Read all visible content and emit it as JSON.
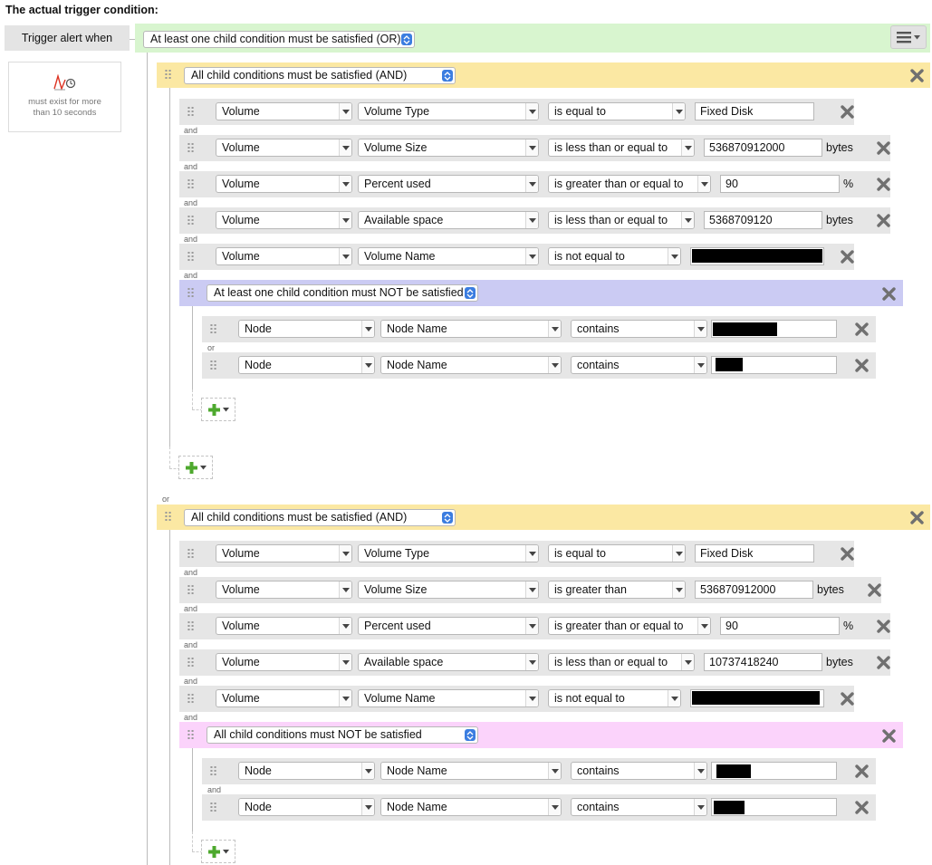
{
  "heading": "The actual trigger condition:",
  "trigger_label": "Trigger alert when",
  "info": {
    "line1": "must exist for more",
    "line2": "than 10 seconds"
  },
  "root_condition": "At least one child condition must be satisfied (OR)",
  "conjunctions": {
    "and": "and",
    "or": "or"
  },
  "groups": [
    {
      "label": "All child conditions must be satisfied (AND)",
      "rows": [
        {
          "entity": "Volume",
          "field": "Volume Type",
          "op": "is equal to",
          "value": "Fixed Disk",
          "unit": ""
        },
        {
          "entity": "Volume",
          "field": "Volume Size",
          "op": "is less than or equal to",
          "value": "536870912000",
          "unit": "bytes"
        },
        {
          "entity": "Volume",
          "field": "Percent used",
          "op": "is greater than or equal to",
          "value": "90",
          "unit": "%"
        },
        {
          "entity": "Volume",
          "field": "Available space",
          "op": "is less than or equal to",
          "value": "5368709120",
          "unit": "bytes"
        },
        {
          "entity": "Volume",
          "field": "Volume Name",
          "op": "is not equal to",
          "value": "",
          "unit": ""
        }
      ],
      "subgroup": {
        "label": "At least one child condition must NOT be satisfied",
        "rows": [
          {
            "entity": "Node",
            "field": "Node Name",
            "op": "contains",
            "value": ""
          },
          {
            "entity": "Node",
            "field": "Node Name",
            "op": "contains",
            "value": ""
          }
        ]
      }
    },
    {
      "label": "All child conditions must be satisfied (AND)",
      "rows": [
        {
          "entity": "Volume",
          "field": "Volume Type",
          "op": "is equal to",
          "value": "Fixed Disk",
          "unit": ""
        },
        {
          "entity": "Volume",
          "field": "Volume Size",
          "op": "is greater than",
          "value": "536870912000",
          "unit": "bytes"
        },
        {
          "entity": "Volume",
          "field": "Percent used",
          "op": "is greater than or equal to",
          "value": "90",
          "unit": "%"
        },
        {
          "entity": "Volume",
          "field": "Available space",
          "op": "is less than or equal to",
          "value": "10737418240",
          "unit": "bytes"
        },
        {
          "entity": "Volume",
          "field": "Volume Name",
          "op": "is not equal to",
          "value": "",
          "unit": ""
        }
      ],
      "subgroup": {
        "label": "All child conditions must NOT be satisfied",
        "rows": [
          {
            "entity": "Node",
            "field": "Node Name",
            "op": "contains",
            "value": ""
          },
          {
            "entity": "Node",
            "field": "Node Name",
            "op": "contains",
            "value": ""
          }
        ]
      }
    }
  ],
  "icons": {
    "grip": "drag-handle-icon",
    "remove": "remove-x-icon",
    "add": "add-plus-icon",
    "menu": "hamburger-menu-icon",
    "trend": "trend-chart-icon",
    "dropdown": "chevron-down-icon",
    "spinner": "updown-spinner-icon"
  },
  "colors": {
    "root_band": "#d8f5cf",
    "and_group": "#fbe8a3",
    "or_not_group": "#cbcbf3",
    "and_not_group": "#fbd3fb",
    "row": "#e6e6e6",
    "remove_x": "#6f6f6f",
    "add_plus": "#4ea92e",
    "select_spinner": "#3b7de0"
  }
}
